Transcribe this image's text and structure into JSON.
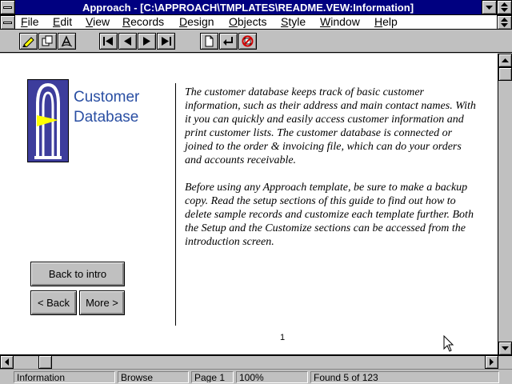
{
  "window": {
    "title": "Approach - [C:\\APPROACH\\TMPLATES\\README.VEW:Information]"
  },
  "menu": {
    "items": [
      {
        "label": "File",
        "accel": "F",
        "rest": "ile"
      },
      {
        "label": "Edit",
        "accel": "E",
        "rest": "dit"
      },
      {
        "label": "View",
        "accel": "V",
        "rest": "iew"
      },
      {
        "label": "Records",
        "accel": "R",
        "rest": "ecords"
      },
      {
        "label": "Design",
        "accel": "D",
        "rest": "esign"
      },
      {
        "label": "Objects",
        "accel": "O",
        "rest": "bjects"
      },
      {
        "label": "Style",
        "accel": "S",
        "rest": "tyle"
      },
      {
        "label": "Window",
        "accel": "W",
        "rest": "indow"
      },
      {
        "label": "Help",
        "accel": "H",
        "rest": "elp"
      }
    ]
  },
  "toolbar": {
    "icons": [
      "pencil-icon",
      "copy-icon",
      "fonts-icon",
      "first-record-icon",
      "previous-record-icon",
      "next-record-icon",
      "last-record-icon",
      "new-record-icon",
      "enter-icon",
      "delete-icon"
    ]
  },
  "content": {
    "logo_title_line1": "Customer",
    "logo_title_line2": "Database",
    "paragraph1": "The customer database keeps track of basic customer information, such as their address and main contact names. With it you can quickly and easily access customer information and print customer lists. The customer database is connected or joined to the order & invoicing file, which can do your orders and accounts receivable.",
    "paragraph2": "Before using any Approach template, be sure to make a backup copy. Read the setup sections of this guide to find out how to delete sample records and customize each template further. Both the Setup and the Customize sections can be accessed from the introduction screen.",
    "page_number": "1"
  },
  "buttons": {
    "back_to_intro": "Back to intro",
    "back": "< Back",
    "more": "More >"
  },
  "status": {
    "view": "Information",
    "mode": "Browse",
    "page": "Page 1",
    "zoom": "100%",
    "found": "Found 5 of 123"
  },
  "colors": {
    "title_bar": "#000080",
    "logo_bg": "#3d3d9c",
    "logo_text": "#2a4fa3",
    "delete_icon": "#d00000"
  }
}
